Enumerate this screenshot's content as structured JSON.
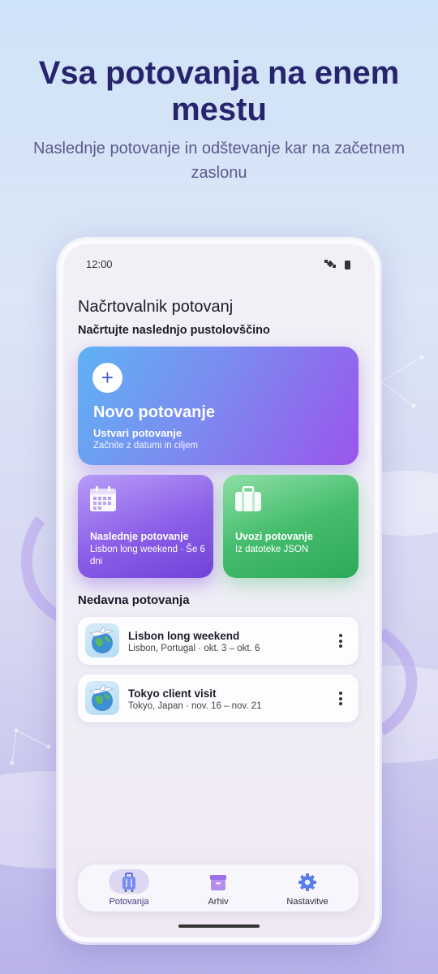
{
  "promo": {
    "headline": "Vsa potovanja na enem mestu",
    "subline": "Naslednje potovanje in odštevanje kar na začetnem zaslonu"
  },
  "status_bar": {
    "time": "12:00",
    "icons": [
      "satellite-icon",
      "battery-icon"
    ]
  },
  "app": {
    "title": "Načrtovalnik potovanj",
    "subtitle": "Načrtujte naslednjo pustolovščino"
  },
  "new_trip": {
    "title": "Novo potovanje",
    "action": "Ustvari potovanje",
    "hint": "Začnite z datumi in ciljem",
    "icon": "plus-icon"
  },
  "next_trip": {
    "title": "Naslednje potovanje",
    "detail": "Lisbon long weekend · Še 6 dni",
    "icon": "calendar-icon"
  },
  "import_trip": {
    "title": "Uvozi potovanje",
    "detail": "Iz datoteke JSON",
    "icon": "suitcase-icon"
  },
  "recent": {
    "heading": "Nedavna potovanja",
    "items": [
      {
        "name": "Lisbon long weekend",
        "meta": "Lisbon, Portugal · okt. 3 – okt. 6",
        "icon": "globe-plane-icon"
      },
      {
        "name": "Tokyo client visit",
        "meta": "Tokyo, Japan · nov. 16 – nov. 21",
        "icon": "globe-plane-icon"
      }
    ]
  },
  "nav": {
    "items": [
      {
        "label": "Potovanja",
        "icon": "luggage-icon",
        "active": true
      },
      {
        "label": "Arhiv",
        "icon": "archive-box-icon",
        "active": false
      },
      {
        "label": "Nastavitve",
        "icon": "gear-icon",
        "active": false
      }
    ]
  },
  "colors": {
    "headline": "#27246e",
    "new_trip_gradient": [
      "#5fb2f4",
      "#9a55ec"
    ],
    "next_trip_gradient": [
      "#b79cf7",
      "#7243d8"
    ],
    "import_gradient": [
      "#8fdfa6",
      "#2da85a"
    ]
  }
}
